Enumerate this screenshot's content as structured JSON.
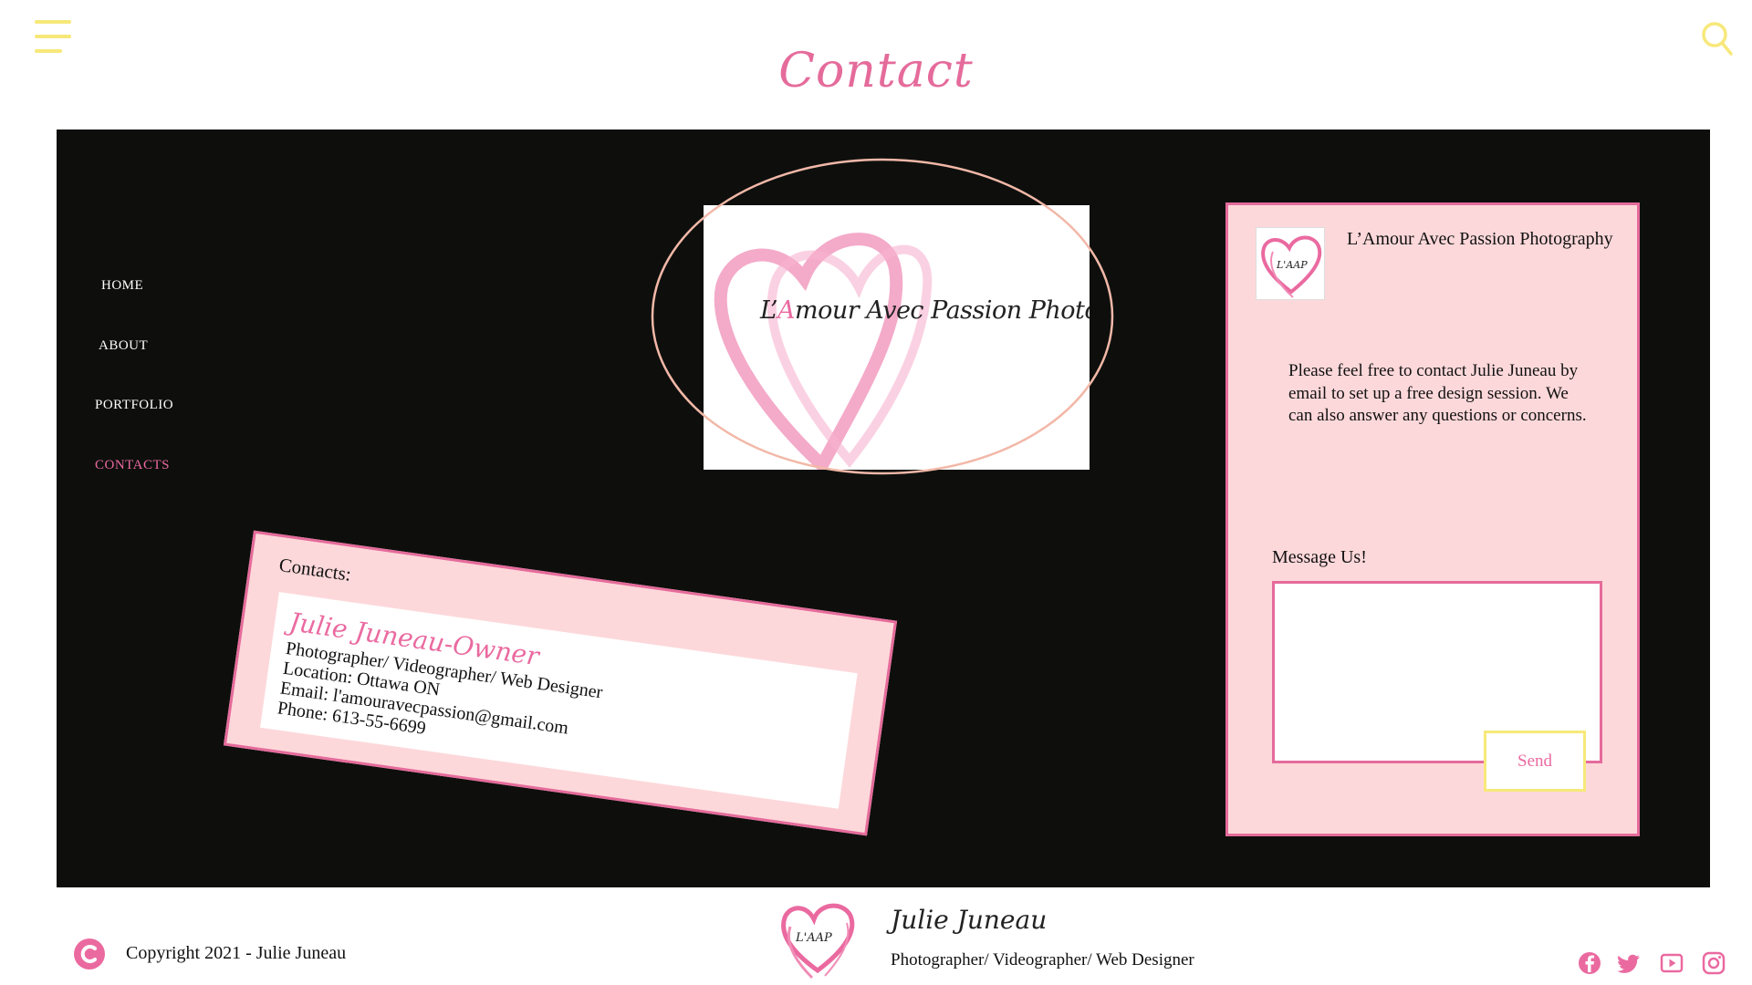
{
  "page": {
    "title": "Contact"
  },
  "nav": {
    "items": [
      {
        "label": "HOME",
        "active": false
      },
      {
        "label": "ABOUT",
        "active": false
      },
      {
        "label": "PORTFOLIO",
        "active": false
      },
      {
        "label": "CONTACTS",
        "active": true
      }
    ]
  },
  "logo": {
    "text_prefix": "L’",
    "text_a": "A",
    "text_rest": "mour Avec Passion Photography"
  },
  "message_card": {
    "brand": "L’Amour Avec Passion Photography",
    "body": "Please feel free to contact Julie Juneau by email to set up a free design session. We can also answer any questions or concerns.",
    "message_label": "Message Us!",
    "message_value": "",
    "send_label": "Send"
  },
  "contact_card": {
    "heading": "Contacts:",
    "owner": "Julie Juneau-Owner",
    "role": "Photographer/ Videographer/ Web Designer",
    "location": "Location: Ottawa ON",
    "email": "Email: l'amouravecpassion@gmail.com",
    "phone": "Phone: 613-55-6699"
  },
  "footer": {
    "copyright": "Copyright 2021 - Julie Juneau",
    "name": "Julie Juneau",
    "tagline": "Photographer/ Videographer/ Web Designer",
    "logo_initials": "L'AAP",
    "social": [
      "facebook-icon",
      "twitter-icon",
      "youtube-icon",
      "instagram-icon"
    ]
  },
  "colors": {
    "accent_pink": "#ea6aa0",
    "card_pink": "#fdd8da",
    "yellow": "#f7e87a",
    "panel_black": "#0e0f0d"
  }
}
